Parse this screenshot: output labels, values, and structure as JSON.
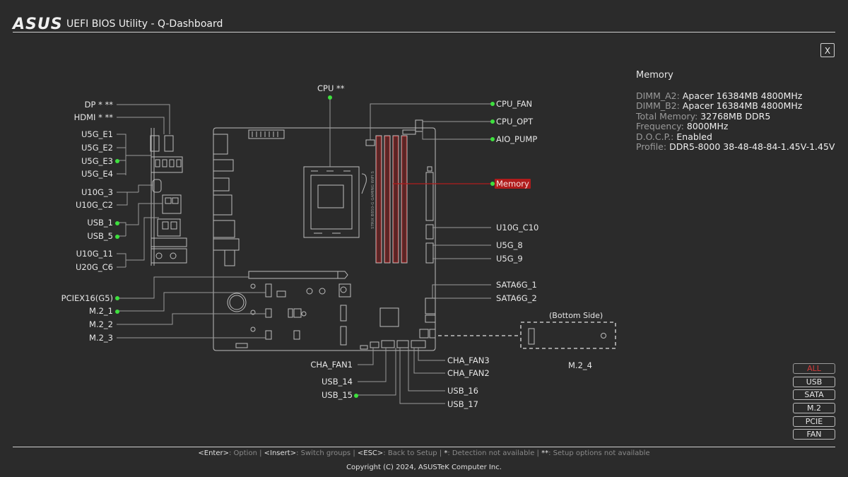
{
  "header": {
    "logo": "ASUS",
    "title": "UEFI BIOS Utility - Q-Dashboard",
    "close_label": "X"
  },
  "info_panel": {
    "title": "Memory",
    "rows": [
      {
        "key": "DIMM_A2:",
        "value": "Apacer 16384MB 4800MHz"
      },
      {
        "key": "DIMM_B2:",
        "value": "Apacer 16384MB 4800MHz"
      },
      {
        "key": "Total Memory:",
        "value": "32768MB DDR5"
      },
      {
        "key": "Frequency:",
        "value": "8000MHz"
      },
      {
        "key": "D.O.C.P.:",
        "value": "Enabled"
      },
      {
        "key": "Profile:",
        "value": "DDR5-8000 38-48-48-84-1.45V-1.45V"
      }
    ]
  },
  "labels": {
    "left": {
      "dp": "DP * **",
      "hdmi": "HDMI * **",
      "u5g_e1": "U5G_E1",
      "u5g_e2": "U5G_E2",
      "u5g_e3": "U5G_E3",
      "u5g_e4": "U5G_E4",
      "u10g_3": "U10G_3",
      "u10g_c2": "U10G_C2",
      "usb_1": "USB_1",
      "usb_5": "USB_5",
      "u10g_11": "U10G_11",
      "u20g_c6": "U20G_C6",
      "pciex16": "PCIEX16(G5)",
      "m2_1": "M.2_1",
      "m2_2": "M.2_2",
      "m2_3": "M.2_3"
    },
    "top": {
      "cpu": "CPU **"
    },
    "right": {
      "cpu_fan": "CPU_FAN",
      "cpu_opt": "CPU_OPT",
      "aio_pump": "AIO_PUMP",
      "memory": "Memory",
      "u10g_c10": "U10G_C10",
      "u5g_8": "U5G_8",
      "u5g_9": "U5G_9",
      "sata6g_1": "SATA6G_1",
      "sata6g_2": "SATA6G_2"
    },
    "bottom": {
      "cha_fan1": "CHA_FAN1",
      "usb_14": "USB_14",
      "usb_15": "USB_15",
      "cha_fan3": "CHA_FAN3",
      "cha_fan2": "CHA_FAN2",
      "usb_16": "USB_16",
      "usb_17": "USB_17"
    },
    "bottom_side": {
      "caption": "(Bottom Side)",
      "m2_4": "M.2_4"
    }
  },
  "board_silkscreen": "STRIX B850-G GAMING WIFI S",
  "filters": [
    "ALL",
    "USB",
    "SATA",
    "M.2",
    "PCIE",
    "FAN"
  ],
  "footer": {
    "hints": [
      {
        "key": "<Enter>",
        "desc": ": Option"
      },
      {
        "key": "<Insert>",
        "desc": ": Switch groups"
      },
      {
        "key": "<ESC>",
        "desc": ": Back to Setup"
      },
      {
        "key": "*",
        "desc": ": Detection not available"
      },
      {
        "key": "**",
        "desc": ": Setup options not available"
      }
    ],
    "copyright": "Copyright (C) 2024, ASUSTeK Computer Inc."
  },
  "colors": {
    "accent_red": "#b01c1c",
    "dot_green": "#3ee03e",
    "line": "#bdbdbd",
    "bg": "#2b2b2b"
  }
}
